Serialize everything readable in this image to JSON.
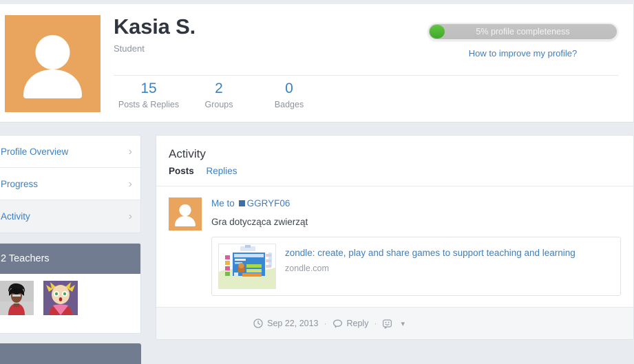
{
  "profile": {
    "avatar_icon": "user-placeholder-icon",
    "name": "Kasia S.",
    "role": "Student",
    "stats": [
      {
        "value": "15",
        "label": "Posts & Replies"
      },
      {
        "value": "2",
        "label": "Groups"
      },
      {
        "value": "0",
        "label": "Badges"
      }
    ],
    "completeness": {
      "text": "5% profile completeness",
      "percent": 5,
      "fill_color": "#4fb52e",
      "track_color": "#c0c0c0",
      "improve_link": "How to improve my profile?"
    }
  },
  "sidebar": {
    "nav": [
      {
        "label": "Profile Overview",
        "active": false,
        "chevron": "chevron-right-icon"
      },
      {
        "label": "Progress",
        "active": false,
        "chevron": "chevron-right-icon"
      },
      {
        "label": "Activity",
        "active": true,
        "chevron": "chevron-right-icon"
      }
    ],
    "teachers_panel": {
      "title": "2 Teachers",
      "header_color": "#717c91",
      "avatars": [
        {
          "name": "teacher-avatar-1"
        },
        {
          "name": "teacher-avatar-2"
        }
      ]
    }
  },
  "activity": {
    "title": "Activity",
    "tabs": [
      {
        "label": "Posts",
        "active": true
      },
      {
        "label": "Replies",
        "active": false
      }
    ],
    "posts": [
      {
        "author": "Me",
        "to_word": "to",
        "group": "GGRYF06",
        "group_swatch_color": "#3a6fa8",
        "avatar_icon": "user-placeholder-icon",
        "text": "Gra dotycząca zwierząt",
        "link_preview": {
          "title": "zondle: create, play and share games to support teaching and learning",
          "domain": "zondle.com",
          "thumb_name": "link-preview-thumbnail"
        },
        "footer": {
          "date_icon": "clock-icon",
          "date": "Sep 22, 2013",
          "separator": "·",
          "reply_icon": "speech-bubble-icon",
          "reply_label": "Reply",
          "reaction_icon": "smiley-icon",
          "caret_icon": "chevron-down-icon"
        }
      }
    ]
  }
}
